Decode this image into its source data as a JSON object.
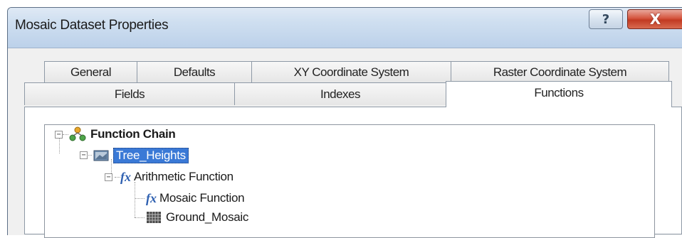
{
  "window": {
    "title": "Mosaic Dataset Properties",
    "help_glyph": "?",
    "close_glyph": "X"
  },
  "tabs_row1": [
    {
      "label": "General"
    },
    {
      "label": "Defaults"
    },
    {
      "label": "XY Coordinate System"
    },
    {
      "label": "Raster Coordinate System"
    }
  ],
  "tabs_row2": [
    {
      "label": "Fields"
    },
    {
      "label": "Indexes"
    },
    {
      "label": "Functions"
    }
  ],
  "active_tab": "Functions",
  "tree": {
    "root": {
      "label": "Function Chain",
      "icon": "function-chain-icon",
      "expander": "−"
    },
    "raster": {
      "label": "Tree_Heights",
      "icon": "raster-dataset-icon",
      "expander": "−",
      "selected": true
    },
    "arith": {
      "label": "Arithmetic Function",
      "icon_text": "fx",
      "expander": "−"
    },
    "mosaic": {
      "label": "Mosaic Function",
      "icon_text": "fx"
    },
    "ground": {
      "label": "Ground_Mosaic",
      "icon": "mosaic-dataset-icon"
    }
  },
  "colors": {
    "selection": "#3a79d6",
    "close_red": "#c23a22",
    "titlebar": "#cfdff0"
  }
}
